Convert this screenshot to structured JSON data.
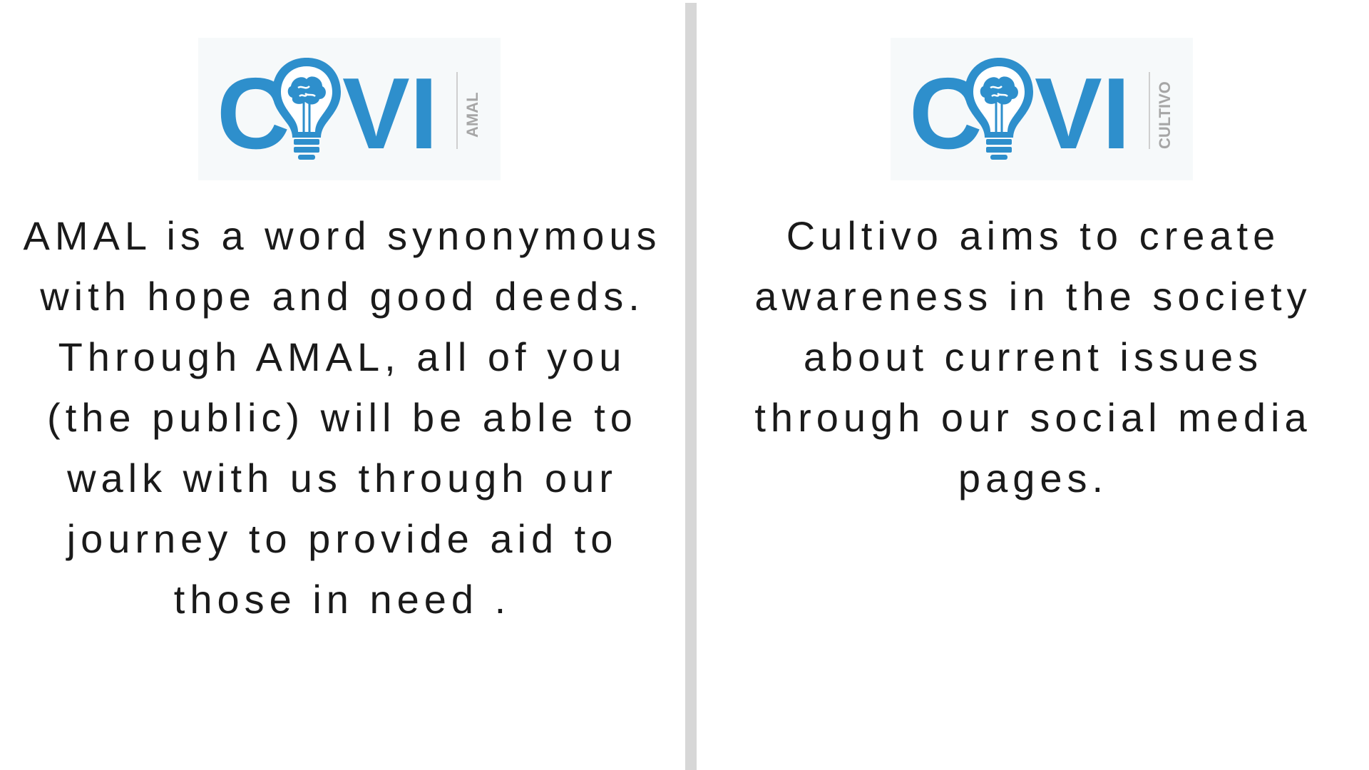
{
  "left_panel": {
    "logo": {
      "wordmark_start": "C",
      "wordmark_end": "VI",
      "subtitle": "AMAL",
      "icon": "lightbulb-brain-icon"
    },
    "description": "AMAL is a word synonymous with hope and good deeds. Through AMAL, all of you (the public) will be able to walk with us through our journey to provide aid to those in need ."
  },
  "right_panel": {
    "logo": {
      "wordmark_start": "C",
      "wordmark_end": "VI",
      "subtitle": "CULTIVO",
      "icon": "lightbulb-brain-icon"
    },
    "description": "Cultivo aims to create awareness in the society about current issues through our social media pages."
  },
  "colors": {
    "brand_blue": "#2e8fcc",
    "subtitle_gray": "#a6a6a6",
    "text": "#1a1a1a",
    "divider": "#d7d7d7"
  }
}
